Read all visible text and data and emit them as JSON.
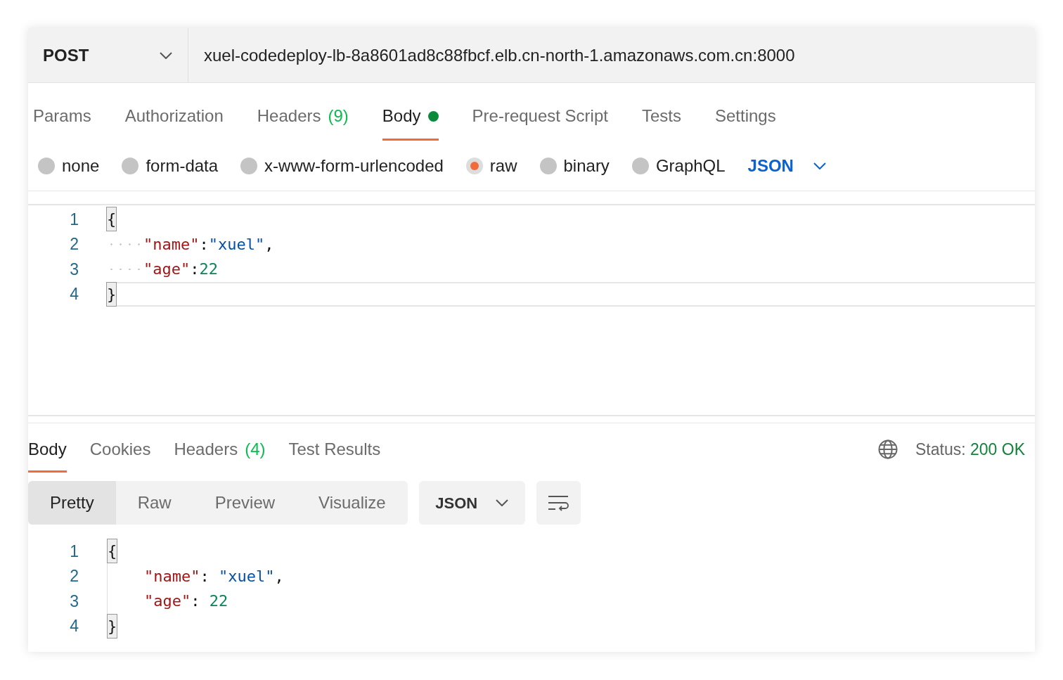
{
  "request": {
    "method": "POST",
    "url": "xuel-codedeploy-lb-8a8601ad8c88fbcf.elb.cn-north-1.amazonaws.com.cn:8000"
  },
  "request_tabs": [
    {
      "label": "Params",
      "selected": false
    },
    {
      "label": "Authorization",
      "selected": false
    },
    {
      "label": "Headers",
      "count": "(9)",
      "selected": false
    },
    {
      "label": "Body",
      "indicator": true,
      "selected": true
    },
    {
      "label": "Pre-request Script",
      "selected": false
    },
    {
      "label": "Tests",
      "selected": false
    },
    {
      "label": "Settings",
      "selected": false
    }
  ],
  "body_types": [
    {
      "label": "none",
      "selected": false
    },
    {
      "label": "form-data",
      "selected": false
    },
    {
      "label": "x-www-form-urlencoded",
      "selected": false
    },
    {
      "label": "raw",
      "selected": true
    },
    {
      "label": "binary",
      "selected": false
    },
    {
      "label": "GraphQL",
      "selected": false
    }
  ],
  "body_language": "JSON",
  "request_editor": [
    {
      "number": "1",
      "active": false,
      "tokens": [
        {
          "kind": "bracket",
          "text": "{"
        }
      ]
    },
    {
      "number": "2",
      "active": false,
      "tokens": [
        {
          "kind": "indent"
        },
        {
          "kind": "key",
          "text": "\"name\""
        },
        {
          "kind": "punct",
          "text": ":"
        },
        {
          "kind": "string",
          "text": "\"xuel\""
        },
        {
          "kind": "punct",
          "text": ","
        }
      ]
    },
    {
      "number": "3",
      "active": false,
      "tokens": [
        {
          "kind": "indent"
        },
        {
          "kind": "key",
          "text": "\"age\""
        },
        {
          "kind": "punct",
          "text": ":"
        },
        {
          "kind": "number",
          "text": "22"
        }
      ]
    },
    {
      "number": "4",
      "active": true,
      "tokens": [
        {
          "kind": "bracket",
          "text": "}"
        }
      ]
    }
  ],
  "response_tabs": [
    {
      "label": "Body",
      "selected": true
    },
    {
      "label": "Cookies",
      "selected": false
    },
    {
      "label": "Headers",
      "count": "(4)",
      "selected": false
    },
    {
      "label": "Test Results",
      "selected": false
    }
  ],
  "status": {
    "label": "Status:",
    "value": "200 OK"
  },
  "view_modes": [
    {
      "label": "Pretty",
      "selected": true
    },
    {
      "label": "Raw",
      "selected": false
    },
    {
      "label": "Preview",
      "selected": false
    },
    {
      "label": "Visualize",
      "selected": false
    }
  ],
  "response_format": "JSON",
  "response_body": [
    {
      "number": "1",
      "tokens": [
        {
          "kind": "bracket",
          "text": "{"
        }
      ]
    },
    {
      "number": "2",
      "tokens": [
        {
          "kind": "indent"
        },
        {
          "kind": "key",
          "text": "\"name\""
        },
        {
          "kind": "punct",
          "text": ": "
        },
        {
          "kind": "string",
          "text": "\"xuel\""
        },
        {
          "kind": "punct",
          "text": ","
        }
      ]
    },
    {
      "number": "3",
      "tokens": [
        {
          "kind": "indent"
        },
        {
          "kind": "key",
          "text": "\"age\""
        },
        {
          "kind": "punct",
          "text": ": "
        },
        {
          "kind": "number",
          "text": "22"
        }
      ]
    },
    {
      "number": "4",
      "tokens": [
        {
          "kind": "bracket",
          "text": "}"
        }
      ]
    }
  ]
}
